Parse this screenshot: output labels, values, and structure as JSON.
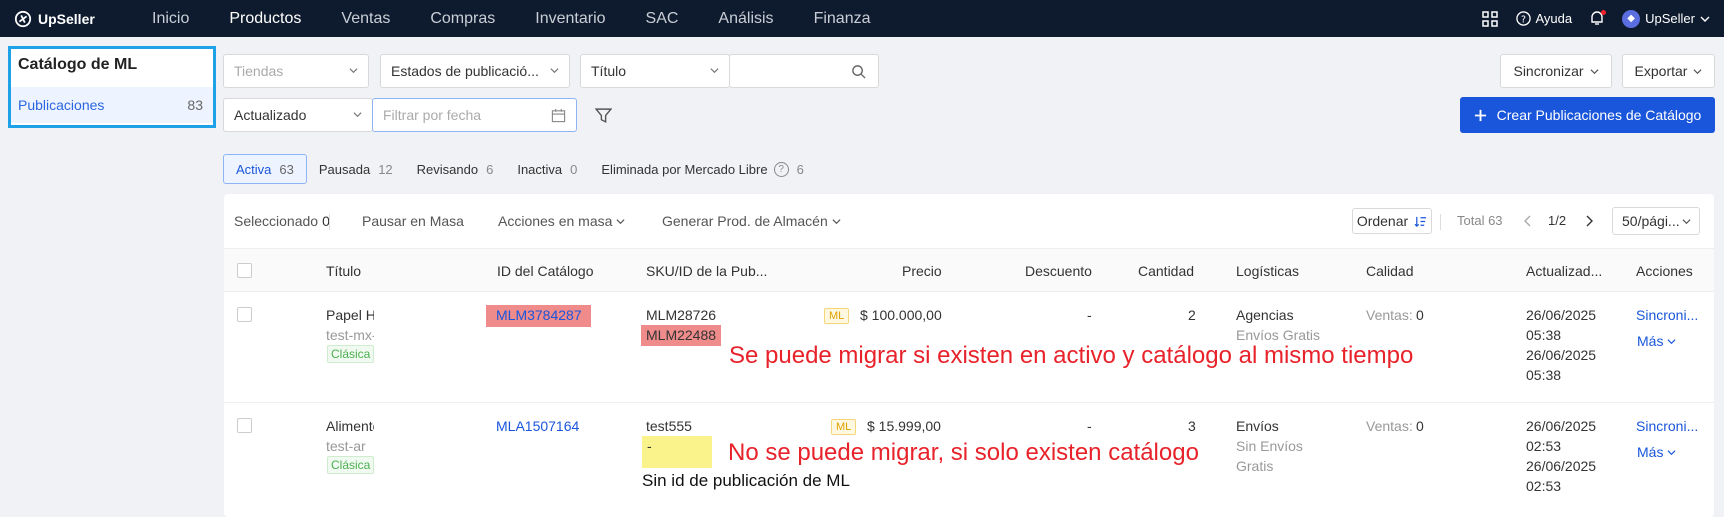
{
  "app": {
    "brand": "UpSeller"
  },
  "topnav": {
    "items": [
      "Inicio",
      "Productos",
      "Ventas",
      "Compras",
      "Inventario",
      "SAC",
      "Análisis",
      "Finanza"
    ],
    "active_index": 1,
    "help": "Ayuda",
    "user": "UpSeller"
  },
  "sidebar": {
    "title": "Catálogo de ML",
    "item_label": "Publicaciones",
    "item_count": "83"
  },
  "filters": {
    "stores_placeholder": "Tiendas",
    "status_value": "Estados de publicació...",
    "field_value": "Título",
    "search_value": "",
    "date_type_value": "Actualizado",
    "date_placeholder": "Filtrar por fecha"
  },
  "actions": {
    "sync": "Sincronizar",
    "export": "Exportar",
    "create": "Crear Publicaciones de Catálogo"
  },
  "tabs": [
    {
      "label": "Activa",
      "count": "63"
    },
    {
      "label": "Pausada",
      "count": "12"
    },
    {
      "label": "Revisando",
      "count": "6"
    },
    {
      "label": "Inactiva",
      "count": "0"
    },
    {
      "label": "Eliminada por Mercado Libre",
      "count": "6"
    }
  ],
  "toolbar": {
    "selected_label": "Seleccionado",
    "selected_count": "0",
    "pause_mass": "Pausar en Masa",
    "mass_actions": "Acciones en masa",
    "gen_warehouse": "Generar Prod. de Almacén",
    "sort": "Ordenar",
    "total": "Total 63",
    "page": "1/2",
    "page_size": "50/pági..."
  },
  "columns": [
    "Título",
    "ID del Catálogo",
    "SKU/ID de la Pub...",
    "Precio",
    "Descuento",
    "Cantidad",
    "Logísticas",
    "Calidad",
    "Actualizad...",
    "Acciones"
  ],
  "rows": [
    {
      "title": "Papel H",
      "subtitle": "test-mx-",
      "type": "Clásica",
      "catalog_id": "MLM3784287",
      "sku": "MLM28726",
      "pub_id": "MLM22488",
      "currency_tag": "ML",
      "price": "$ 100.000,00",
      "discount": "-",
      "quantity": "2",
      "logistics": "Agencias",
      "logistics_sub": "Envíos Gratis",
      "quality_label": "Ventas:",
      "quality_value": "0",
      "date1": "26/06/2025",
      "time1": "05:38",
      "date2": "26/06/2025",
      "time2": "05:38",
      "action": "Sincroni...",
      "more": "Más"
    },
    {
      "title": "Alimento",
      "subtitle": "test-ar",
      "type": "Clásica",
      "catalog_id": "MLA1507164",
      "sku": "test555",
      "pub_id": "-",
      "currency_tag": "ML",
      "price": "$ 15.999,00",
      "discount": "-",
      "quantity": "3",
      "logistics": "Envíos",
      "logistics_sub": "Sin Envíos",
      "logistics_sub2": "Gratis",
      "quality_label": "Ventas:",
      "quality_value": "0",
      "date1": "26/06/2025",
      "time1": "02:53",
      "date2": "26/06/2025",
      "time2": "02:53",
      "action": "Sincroni...",
      "more": "Más"
    }
  ],
  "annotations": {
    "note1": "Se puede migrar si existen en activo y catálogo al mismo tiempo",
    "note2": "No se puede migrar, si solo existen  catálogo",
    "note3": "Sin id de publicación de ML"
  },
  "colors": {
    "topbar": "#0e1b2e",
    "primary": "#1a56db",
    "annotation": "#e8222a",
    "sidebar_border": "#1ea1e6"
  }
}
